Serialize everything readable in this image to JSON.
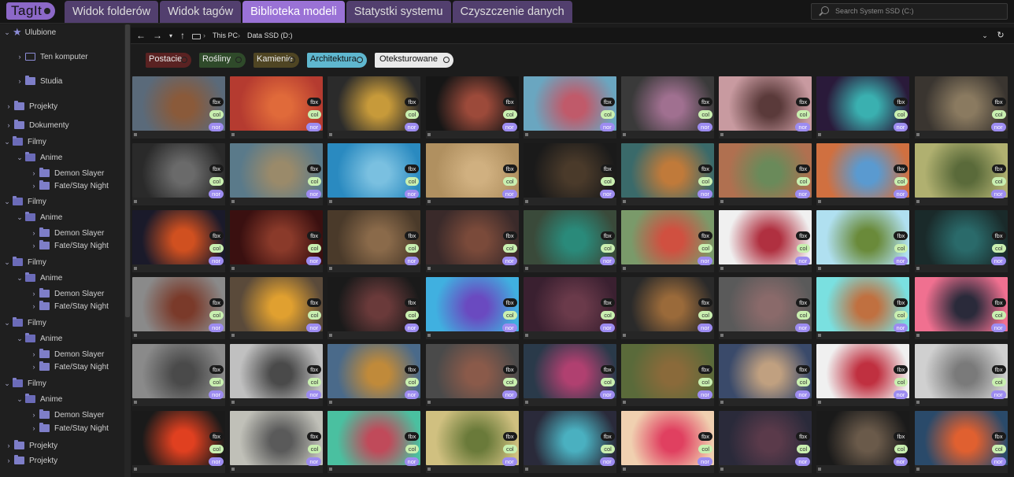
{
  "app": {
    "logo": "TagIt"
  },
  "tabs": [
    {
      "label": "Widok folderów",
      "active": false
    },
    {
      "label": "Widok tagów",
      "active": false
    },
    {
      "label": "Biblioteka modeli",
      "active": true
    },
    {
      "label": "Statystki systemu",
      "active": false
    },
    {
      "label": "Czyszczenie danych",
      "active": false
    }
  ],
  "search": {
    "placeholder": "Search System SSD (C:)"
  },
  "sidebar": {
    "favorites": "Ulubione",
    "computer": "Ten komputer",
    "studia": "Studia",
    "projekty": "Projekty",
    "dokumenty": "Dokumenty",
    "filmy": "Filmy",
    "anime": "Anime",
    "demon": "Demon Slayer",
    "fate": "Fate/Stay Night",
    "projekty2": "Projekty",
    "projekty3": "Projekty"
  },
  "pathbar": {
    "crumb1": "This PC",
    "sep": "›",
    "crumb2": "Data SSD (D:)"
  },
  "tags": [
    {
      "label": "Postacie",
      "color": "#5a2222"
    },
    {
      "label": "Rośliny",
      "color": "#2f4a2a"
    },
    {
      "label": "Kamienie",
      "color": "#4f4523"
    },
    {
      "label": "Architektura",
      "color": "#5fb7cf"
    },
    {
      "label": "Oteksturowane",
      "color": "#e9e9e9"
    }
  ],
  "badges": {
    "fbx": "fbx",
    "col": "col",
    "nor": "nor"
  },
  "models": [
    [
      "#5a6a7a",
      "#8a5a3a"
    ],
    [
      "#b53b30",
      "#e06a3a"
    ],
    [
      "#2b2b2b",
      "#c79a3a"
    ],
    [
      "#161616",
      "#9c4a3a"
    ],
    [
      "#6aa6c0",
      "#c05a6a"
    ],
    [
      "#3a3a3a",
      "#a07090"
    ],
    [
      "#c89aa0",
      "#5a3a3a"
    ],
    [
      "#2a1a3a",
      "#3ab0b0"
    ],
    [
      "#3a3530",
      "#8a7a60"
    ],
    [
      "#2a2a2a",
      "#6a6a6a"
    ],
    [
      "#5a7a8a",
      "#9a8a6a"
    ],
    [
      "#2a8ac0",
      "#7ac0e0"
    ],
    [
      "#b09060",
      "#d0b080"
    ],
    [
      "#1a1a1a",
      "#4a3a2a"
    ],
    [
      "#3a6a6a",
      "#c07a3a"
    ],
    [
      "#b07050",
      "#6a8a5a"
    ],
    [
      "#d07040",
      "#5a9ad0"
    ],
    [
      "#b0b070",
      "#5a6a3a"
    ],
    [
      "#1a1a2a",
      "#d05020"
    ],
    [
      "#3a1010",
      "#8a3a2a"
    ],
    [
      "#4a3a2a",
      "#8a6a4a"
    ],
    [
      "#3a2a2a",
      "#7a4a3a"
    ],
    [
      "#3a4a3a",
      "#2a8a7a"
    ],
    [
      "#7a9a6a",
      "#d05040"
    ],
    [
      "#f0f0f0",
      "#b03040"
    ],
    [
      "#b0e0f0",
      "#6a8a3a"
    ],
    [
      "#1a2a2a",
      "#2a6a6a"
    ],
    [
      "#8a8a8a",
      "#7a3a2a"
    ],
    [
      "#5a4a3a",
      "#e0a030"
    ],
    [
      "#1a1a1a",
      "#6a3a3a"
    ],
    [
      "#40b0e0",
      "#6a4ac0"
    ],
    [
      "#3a2030",
      "#6a3a4a"
    ],
    [
      "#2a2a2a",
      "#9a6a3a"
    ],
    [
      "#5a5a5a",
      "#8a6a6a"
    ],
    [
      "#7ae0e0",
      "#c07040"
    ],
    [
      "#f07090",
      "#2a2a3a"
    ],
    [
      "#8a8a8a",
      "#4a4a4a"
    ],
    [
      "#c0c0c0",
      "#4a4a4a"
    ],
    [
      "#4a6a8a",
      "#c08a3a"
    ],
    [
      "#4a4a4a",
      "#8a5a4a"
    ],
    [
      "#2a3a4a",
      "#b04070"
    ],
    [
      "#5a6a3a",
      "#8a6a3a"
    ],
    [
      "#3a4a6a",
      "#c0a080"
    ],
    [
      "#f0f0f0",
      "#c03040"
    ],
    [
      "#d0d0d0",
      "#7a7a7a"
    ],
    [
      "#1a1a1a",
      "#e04020"
    ],
    [
      "#c0c0b8",
      "#5a5a5a"
    ],
    [
      "#4ac0a0",
      "#c04a5a"
    ],
    [
      "#d0c080",
      "#6a7a3a"
    ],
    [
      "#2a2a3a",
      "#4ab0c0"
    ],
    [
      "#f0d0b0",
      "#e04060"
    ],
    [
      "#2a2a3a",
      "#5a3a4a"
    ],
    [
      "#1a1a1a",
      "#6a5a4a"
    ],
    [
      "#2a4a6a",
      "#e06030"
    ]
  ]
}
